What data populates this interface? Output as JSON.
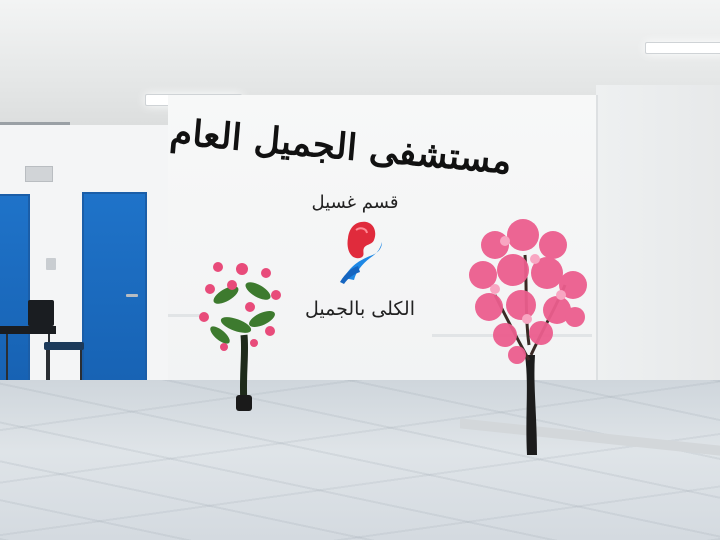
{
  "sign": {
    "title": "مستشفى الجميل العام",
    "department": "قسم غسيل",
    "subtitle": "الكلى بالجميل"
  },
  "logo": {
    "icon": "kidney-in-hand-icon",
    "colors": {
      "kidney": "#e02b3c",
      "hand": "#1e88e5"
    }
  },
  "colors": {
    "door": "#1f6fc4",
    "blossom": "#e84b7a",
    "wall": "#f4f5f6"
  }
}
